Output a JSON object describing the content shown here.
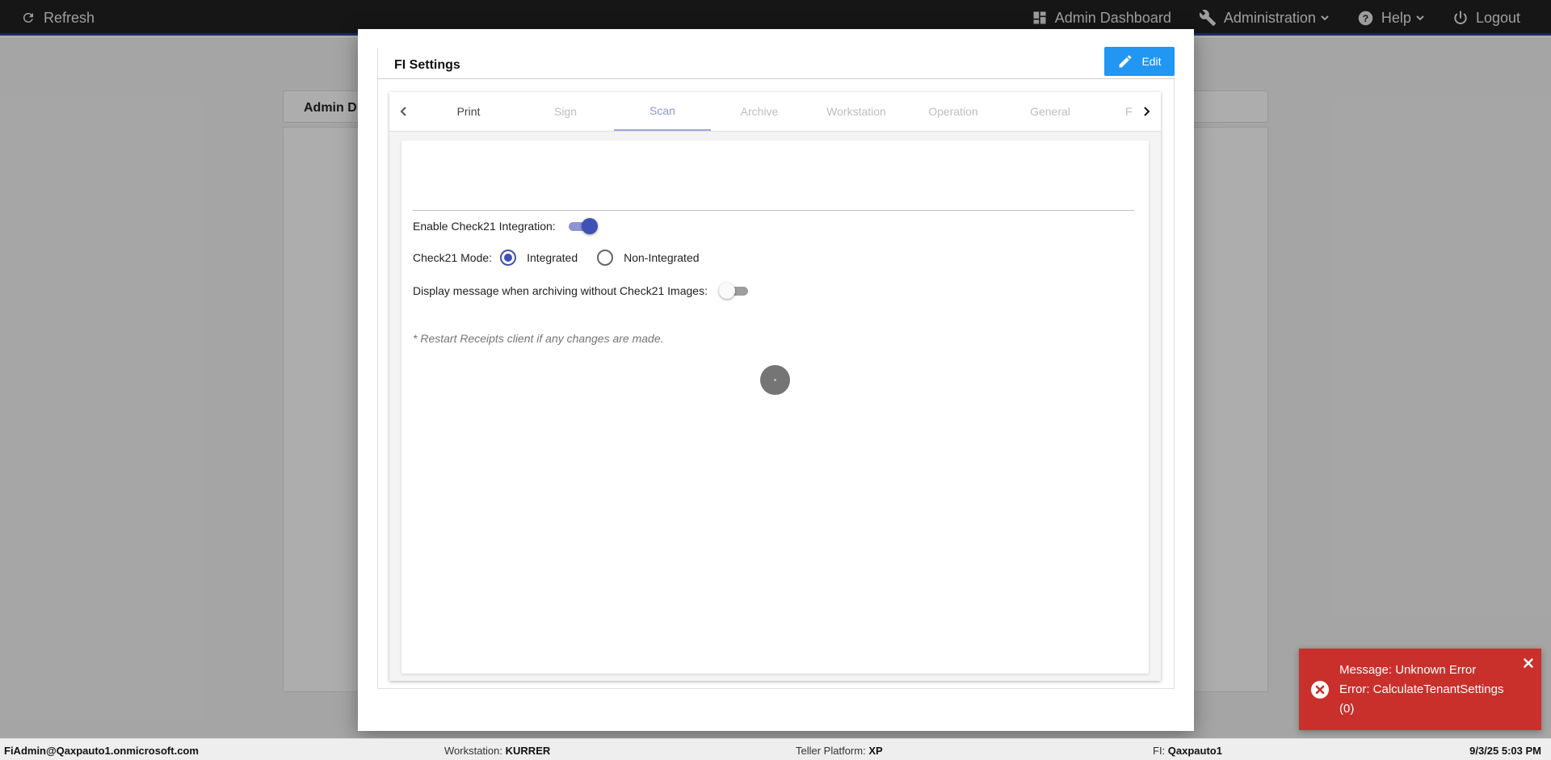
{
  "topbar": {
    "refresh_label": "Refresh",
    "nav": {
      "admin_dashboard": "Admin Dashboard",
      "administration": "Administration",
      "help": "Help",
      "logout": "Logout"
    }
  },
  "background": {
    "card_title": "Admin D"
  },
  "modal": {
    "title": "FI Settings",
    "edit_label": "Edit",
    "tabs": [
      {
        "label": "Print"
      },
      {
        "label": "Sign"
      },
      {
        "label": "Scan"
      },
      {
        "label": "Archive"
      },
      {
        "label": "Workstation"
      },
      {
        "label": "Operation"
      },
      {
        "label": "General"
      },
      {
        "label": "F"
      }
    ],
    "active_tab": "Scan",
    "scan": {
      "enable_check21_label": "Enable Check21 Integration:",
      "enable_check21_value": true,
      "mode_label": "Check21 Mode:",
      "mode_options": [
        "Integrated",
        "Non-Integrated"
      ],
      "mode_selected": "Integrated",
      "display_message_label": "Display message when archiving without Check21 Images:",
      "display_message_value": false,
      "restart_note": "* Restart Receipts client if any changes are made."
    }
  },
  "toast": {
    "line1": "Message: Unknown Error",
    "line2": "Error: CalculateTenantSettings",
    "line3": "(0)"
  },
  "statusbar": {
    "user": "FiAdmin@Qaxpauto1.onmicrosoft.com",
    "workstation_label": "Workstation:",
    "workstation_value": "KURRER",
    "platform_label": "Teller Platform:",
    "platform_value": "XP",
    "fi_label": "FI:",
    "fi_value": "Qaxpauto1",
    "datetime": "9/3/25 5:03 PM"
  },
  "colors": {
    "topbar": "#212121",
    "primary": "#3f51b5",
    "edit_button": "#2196f3",
    "toast": "#c9302c"
  }
}
